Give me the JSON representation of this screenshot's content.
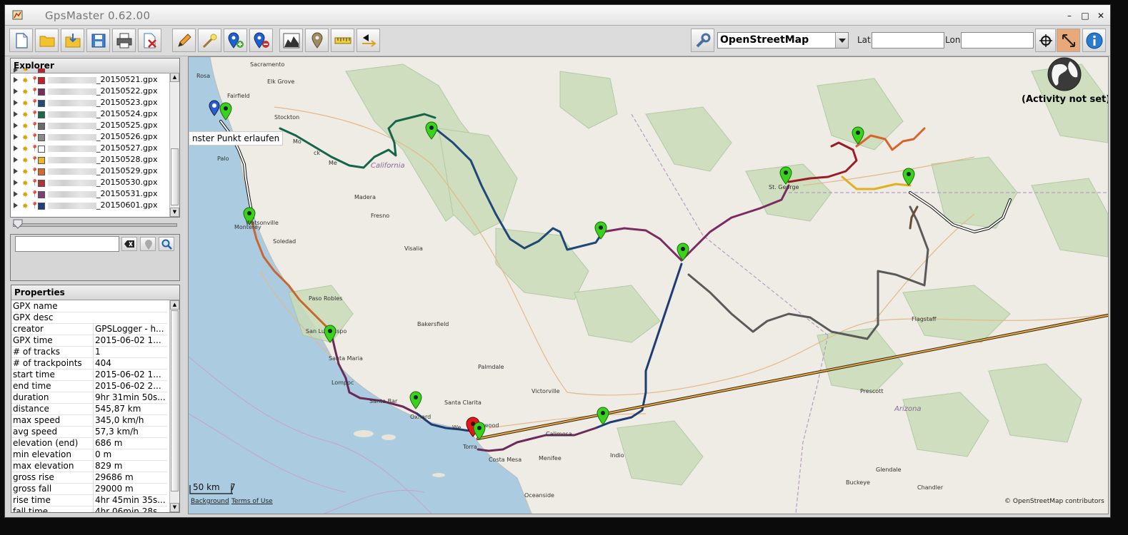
{
  "window": {
    "title": "GpsMaster 0.62.00",
    "minimize": "–",
    "maximize": "□",
    "close": "✕"
  },
  "toolbar": {
    "buttons": [
      "new-file",
      "open-folder",
      "open-from-device",
      "save",
      "print",
      "close-file",
      "edit",
      "magic",
      "add-waypoint",
      "remove-waypoint",
      "elevation-chart",
      "waypoint",
      "measure",
      "direction"
    ],
    "map_provider": "OpenStreetMap",
    "lat_label": "Lat",
    "lon_label": "Lon",
    "lat_value": "",
    "lon_value": ""
  },
  "explorer": {
    "title": "Explorer",
    "files": [
      {
        "name": "_20150521.gpx",
        "color": "#c41f2a"
      },
      {
        "name": "_20150522.gpx",
        "color": "#7b2a62"
      },
      {
        "name": "_20150523.gpx",
        "color": "#1f4a7c"
      },
      {
        "name": "_20150524.gpx",
        "color": "#16694c"
      },
      {
        "name": "_20150525.gpx",
        "color": "#6a6a6a"
      },
      {
        "name": "_20150526.gpx",
        "color": "#8a8a8a"
      },
      {
        "name": "_20150527.gpx",
        "color": "#ffffff"
      },
      {
        "name": "_20150528.gpx",
        "color": "#e9b728"
      },
      {
        "name": "_20150529.gpx",
        "color": "#d6692e"
      },
      {
        "name": "_20150530.gpx",
        "color": "#b03336"
      },
      {
        "name": "_20150531.gpx",
        "color": "#7b3f74"
      },
      {
        "name": "_20150601.gpx",
        "color": "#21407a"
      }
    ]
  },
  "search": {
    "value": ""
  },
  "properties": {
    "title": "Properties",
    "rows": [
      {
        "key": "GPX name",
        "value": ""
      },
      {
        "key": "GPX desc",
        "value": ""
      },
      {
        "key": "creator",
        "value": "GPSLogger - h..."
      },
      {
        "key": "GPX time",
        "value": "2015-06-02 1..."
      },
      {
        "key": "# of tracks",
        "value": "1"
      },
      {
        "key": "# of trackpoints",
        "value": "404"
      },
      {
        "key": "start time",
        "value": "2015-06-02 1..."
      },
      {
        "key": "end time",
        "value": "2015-06-02 2..."
      },
      {
        "key": "duration",
        "value": "9hr 31min 50s..."
      },
      {
        "key": "distance",
        "value": "545,87 km"
      },
      {
        "key": "max speed",
        "value": "345,0 km/h"
      },
      {
        "key": "avg speed",
        "value": "57,3 km/h"
      },
      {
        "key": "elevation (end)",
        "value": "686 m"
      },
      {
        "key": "min elevation",
        "value": "0 m"
      },
      {
        "key": "max elevation",
        "value": "829 m"
      },
      {
        "key": "gross rise",
        "value": "29686 m"
      },
      {
        "key": "gross fall",
        "value": "29000 m"
      },
      {
        "key": "rise time",
        "value": "4hr 45min 35s..."
      },
      {
        "key": "fall time",
        "value": "4hr 06min 28s..."
      }
    ]
  },
  "map": {
    "activity": "(Activity not set)",
    "tooltip": "nster Punkt erlaufen",
    "scale": "50 km",
    "scale_extra": "7",
    "background_link": "Background",
    "terms_link": "Terms of Use",
    "attribution": "© OpenStreetMap contributors",
    "places": {
      "sacramento": "Sacramento",
      "rosa": "Rosa",
      "elkgrove": "Elk Grove",
      "fairfield": "Fairfield",
      "stockton": "Stockton",
      "modesto": "Mo",
      "merced": "Me",
      "tracy": "ck",
      "palo": "Palo",
      "california": "California",
      "watsonville": "Watsonville",
      "monterey": "Monterey",
      "madera": "Madera",
      "fresno": "Fresno",
      "soledad": "Soledad",
      "visalia": "Visalia",
      "pasorobles": "Paso Robles",
      "sanluis": "San Lu",
      "obispo": "ispo",
      "bakersfield": "Bakersfield",
      "santamaria": "Santa Maria",
      "lompoc": "Lompoc",
      "santabarbara": "Santa Bar",
      "oxnard": "Oxnard",
      "santaclarita": "Santa Clarita",
      "palmdale": "Palmdale",
      "victorville": "Victorville",
      "hollywood": "wood",
      "westwood": "We",
      "torrance": "Torra",
      "costamesa": "Costa Mesa",
      "calimesa": "Calimesa",
      "menifee": "Menifee",
      "indio": "Indio",
      "oceanside": "Oceanside",
      "stgeorge": "St. George",
      "flagstaff": "Flagstaff",
      "prescott": "Prescott",
      "arizona": "Arizona",
      "glendale": "Glendale",
      "buckeye": "Buckeye",
      "chandler": "Chandler"
    }
  }
}
